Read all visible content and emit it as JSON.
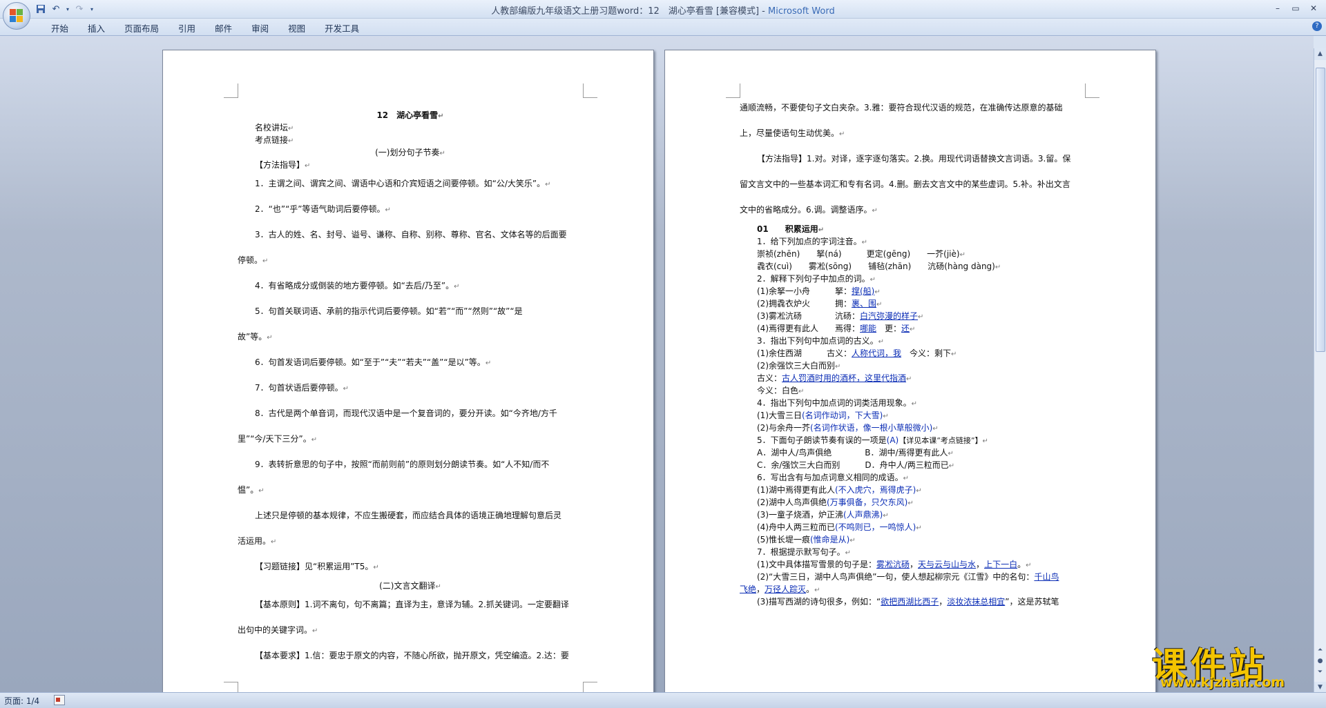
{
  "window": {
    "title_doc": "人教部编版九年级语文上册习题word：12　湖心亭看雪 [兼容模式] - ",
    "title_app": "Microsoft Word"
  },
  "ribbon": {
    "tabs": [
      "开始",
      "插入",
      "页面布局",
      "引用",
      "邮件",
      "审阅",
      "视图",
      "开发工具"
    ]
  },
  "statusbar": {
    "page_info": "页面: 1/4"
  },
  "watermark": {
    "text": "课件站",
    "url": "www.kjzhan.com"
  },
  "page1": {
    "title": "12　湖心亭看雪",
    "l_mingxiao": "名校讲坛",
    "l_kaodian": "考点链接",
    "h_jiezou": "(一)划分句子节奏",
    "l_fangfa": "【方法指导】",
    "r1": "1．主谓之间、谓宾之间、谓语中心语和介宾短语之间要停顿。如“公/大笑乐”。",
    "r2": "2．“也”“乎”等语气助词后要停顿。",
    "r3a": "3．古人的姓、名、封号、谥号、谦称、自称、别称、尊称、官名、文体名等的后面要",
    "r3b": "停顿。",
    "r4": "4．有省略成分或倒装的地方要停顿。如“去后/乃至”。",
    "r5a": "5．句首关联词语、承前的指示代词后要停顿。如“若”“而”“然则”“故”“是",
    "r5b": "故”等。",
    "r6": "6．句首发语词后要停顿。如“至于”“夫”“若夫”“盖”“是以”等。",
    "r7": "7．句首状语后要停顿。",
    "r8a": "8．古代是两个单音词，而现代汉语中是一个复音词的，要分开读。如“今齐地/方千",
    "r8b": "里”“今/天下三分”。",
    "r9a": "9．表转折意思的句子中，按照“而前则前”的原则划分朗读节奏。如“人不知/而不",
    "r9b": "愠”。",
    "sum_a": "上述只是停顿的基本规律，不应生搬硬套，而应结合具体的语境正确地理解句意后灵",
    "sum_b": "活运用。",
    "xiti": "【习题链接】见“积累运用”T5。",
    "h_fanyi": "(二)文言文翻译",
    "yz_a": "【基本原则】1.词不离句，句不离篇；直译为主，意译为辅。2.抓关键词。一定要翻译",
    "yz_b": "出句中的关键字词。",
    "yq_a": "【基本要求】1.信：要忠于原文的内容，不随心所欲，抛开原文，凭空编造。2.达：要"
  },
  "page2": {
    "c1": "通顺流畅，不要使句子文白夹杂。3.雅：要符合现代汉语的规范，在准确传达原意的基础",
    "c2": "上，尽量使语句生动优美。",
    "f1": "【方法指导】1.对。对译，逐字逐句落实。2.换。用现代词语替换文言词语。3.留。保",
    "f2": "留文言文中的一些基本词汇和专有名词。4.删。删去文言文中的某些虚词。5.补。补出文言",
    "f3": "文中的省略成分。6.调。调整语序。",
    "s01": "01　　积累运用",
    "q1": "1．给下列加点的字词注音。",
    "q1a": "崇祯(zhēn)　　拏(ná)　　　更定(gēng)　　一芥(jiè)",
    "q1b": "毳衣(cuì)　　雾凇(sōng)　　铺毡(zhān)　　沆砀(hàng dàng)",
    "q2": "2．解释下列句子中加点的词。",
    "q2_1": "(1)余拏一小舟　　　拏：",
    "q2_1a": "撑(船)",
    "q2_2": "(2)拥毳衣炉火　　　拥：",
    "q2_2a": "裹、围",
    "q2_3": "(3)雾凇沆砀　　　　沆砀：",
    "q2_3a": "白汽弥漫的样子",
    "q2_4": "(4)焉得更有此人　　焉得：",
    "q2_4a": "哪能",
    "q2_4b": "　更：",
    "q2_4c": "还",
    "q3": "3．指出下列句中加点词的古义。",
    "q3_1": "(1)余住西湖　　　古义：",
    "q3_1a": "人称代词，我",
    "q3_1b": "　今义：剩下",
    "q3_2": "(2)余强饮三大白而别",
    "q3_2g": "古义：",
    "q3_2ga": "古人罚酒时用的酒杯，这里代指酒",
    "q3_2j": "今义：白色",
    "q4": "4．指出下列句中加点词的词类活用现象。",
    "q4_1": "(1)大雪三日",
    "q4_1a": "(名词作动词，下大雪)",
    "q4_2": "(2)与余舟一芥",
    "q4_2a": "(名词作状语，像一根小草般微小)",
    "q5": "5．下面句子朗读节奏有误的一项是",
    "q5a": "(A)",
    "q5b": "【详见本课“考点链接”】",
    "q5_A": "A．湖中人/鸟声俱绝　　　　B．湖中/焉得更有此人",
    "q5_C": "C．余/强饮三大白而别　　　D．舟中人/两三粒而已",
    "q6": "6．写出含有与加点词意义相同的成语。",
    "q6_1": "(1)湖中焉得更有此人",
    "q6_1a": "(不入虎穴，焉得虎子)",
    "q6_2": "(2)湖中人鸟声俱绝",
    "q6_2a": "(万事俱备，只欠东风)",
    "q6_3": "(3)一童子烧酒，炉正沸",
    "q6_3a": "(人声鼎沸)",
    "q6_4": "(4)舟中人两三粒而已",
    "q6_4a": "(不鸣则已，一鸣惊人)",
    "q6_5": "(5)惟长堤一痕",
    "q6_5a": "(惟命是从)",
    "q7": "7．根据提示默写句子。",
    "q7_1": "(1)文中具体描写雪景的句子是：",
    "q7_1a": "雾凇沆砀",
    "q7_1b": "天与云与山与水",
    "q7_1c": "上下一白",
    "q7_2": "(2)“大雪三日，湖中人鸟声俱绝”一句，使人想起柳宗元《江雪》中的名句：",
    "q7_2a": "千山鸟",
    "q7_2b": "飞绝",
    "q7_2c": "万径人踪灭",
    "q7_3": "(3)描写西湖的诗句很多，例如：“",
    "q7_3a": "欲把西湖比西子",
    "q7_3b": "淡妆浓抹总相宜",
    "q7_3c": "”，这是苏轼笔"
  },
  "colors": {
    "answer": "#0b2db5",
    "canvas": "#9aa7bd",
    "ribbon": "#d2dff1"
  }
}
